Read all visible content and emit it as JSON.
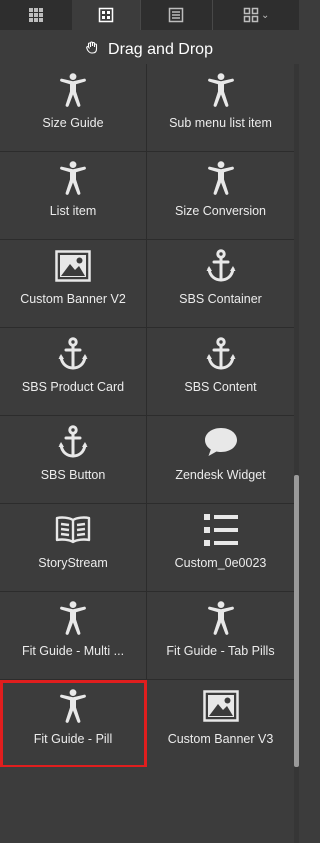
{
  "tabs": [
    {
      "icon": "grid-icon"
    },
    {
      "icon": "widget-grid-icon"
    },
    {
      "icon": "document-list-icon"
    },
    {
      "icon": "layout-dropdown-icon"
    }
  ],
  "header": {
    "title": "Drag and Drop",
    "icon": "hand-icon"
  },
  "items": [
    {
      "label": "Size Guide",
      "icon": "accessibility-icon"
    },
    {
      "label": "Sub menu list item",
      "icon": "accessibility-icon"
    },
    {
      "label": "List item",
      "icon": "accessibility-icon"
    },
    {
      "label": "Size Conversion",
      "icon": "accessibility-icon"
    },
    {
      "label": "Custom Banner V2",
      "icon": "image-icon"
    },
    {
      "label": "SBS Container",
      "icon": "anchor-icon"
    },
    {
      "label": "SBS Product Card",
      "icon": "anchor-icon"
    },
    {
      "label": "SBS Content",
      "icon": "anchor-icon"
    },
    {
      "label": "SBS Button",
      "icon": "anchor-icon"
    },
    {
      "label": "Zendesk Widget",
      "icon": "speech-bubble-icon"
    },
    {
      "label": "StoryStream",
      "icon": "book-icon"
    },
    {
      "label": "Custom_0e0023",
      "icon": "list-icon"
    },
    {
      "label": "Fit Guide - Multi ...",
      "icon": "accessibility-icon"
    },
    {
      "label": "Fit Guide - Tab Pills",
      "icon": "accessibility-icon"
    },
    {
      "label": "Fit Guide - Pill",
      "icon": "accessibility-icon",
      "selected": true
    },
    {
      "label": "Custom Banner V3",
      "icon": "image-icon"
    }
  ],
  "colors": {
    "background": "#3c3c3c",
    "selection": "#e01e1e"
  }
}
